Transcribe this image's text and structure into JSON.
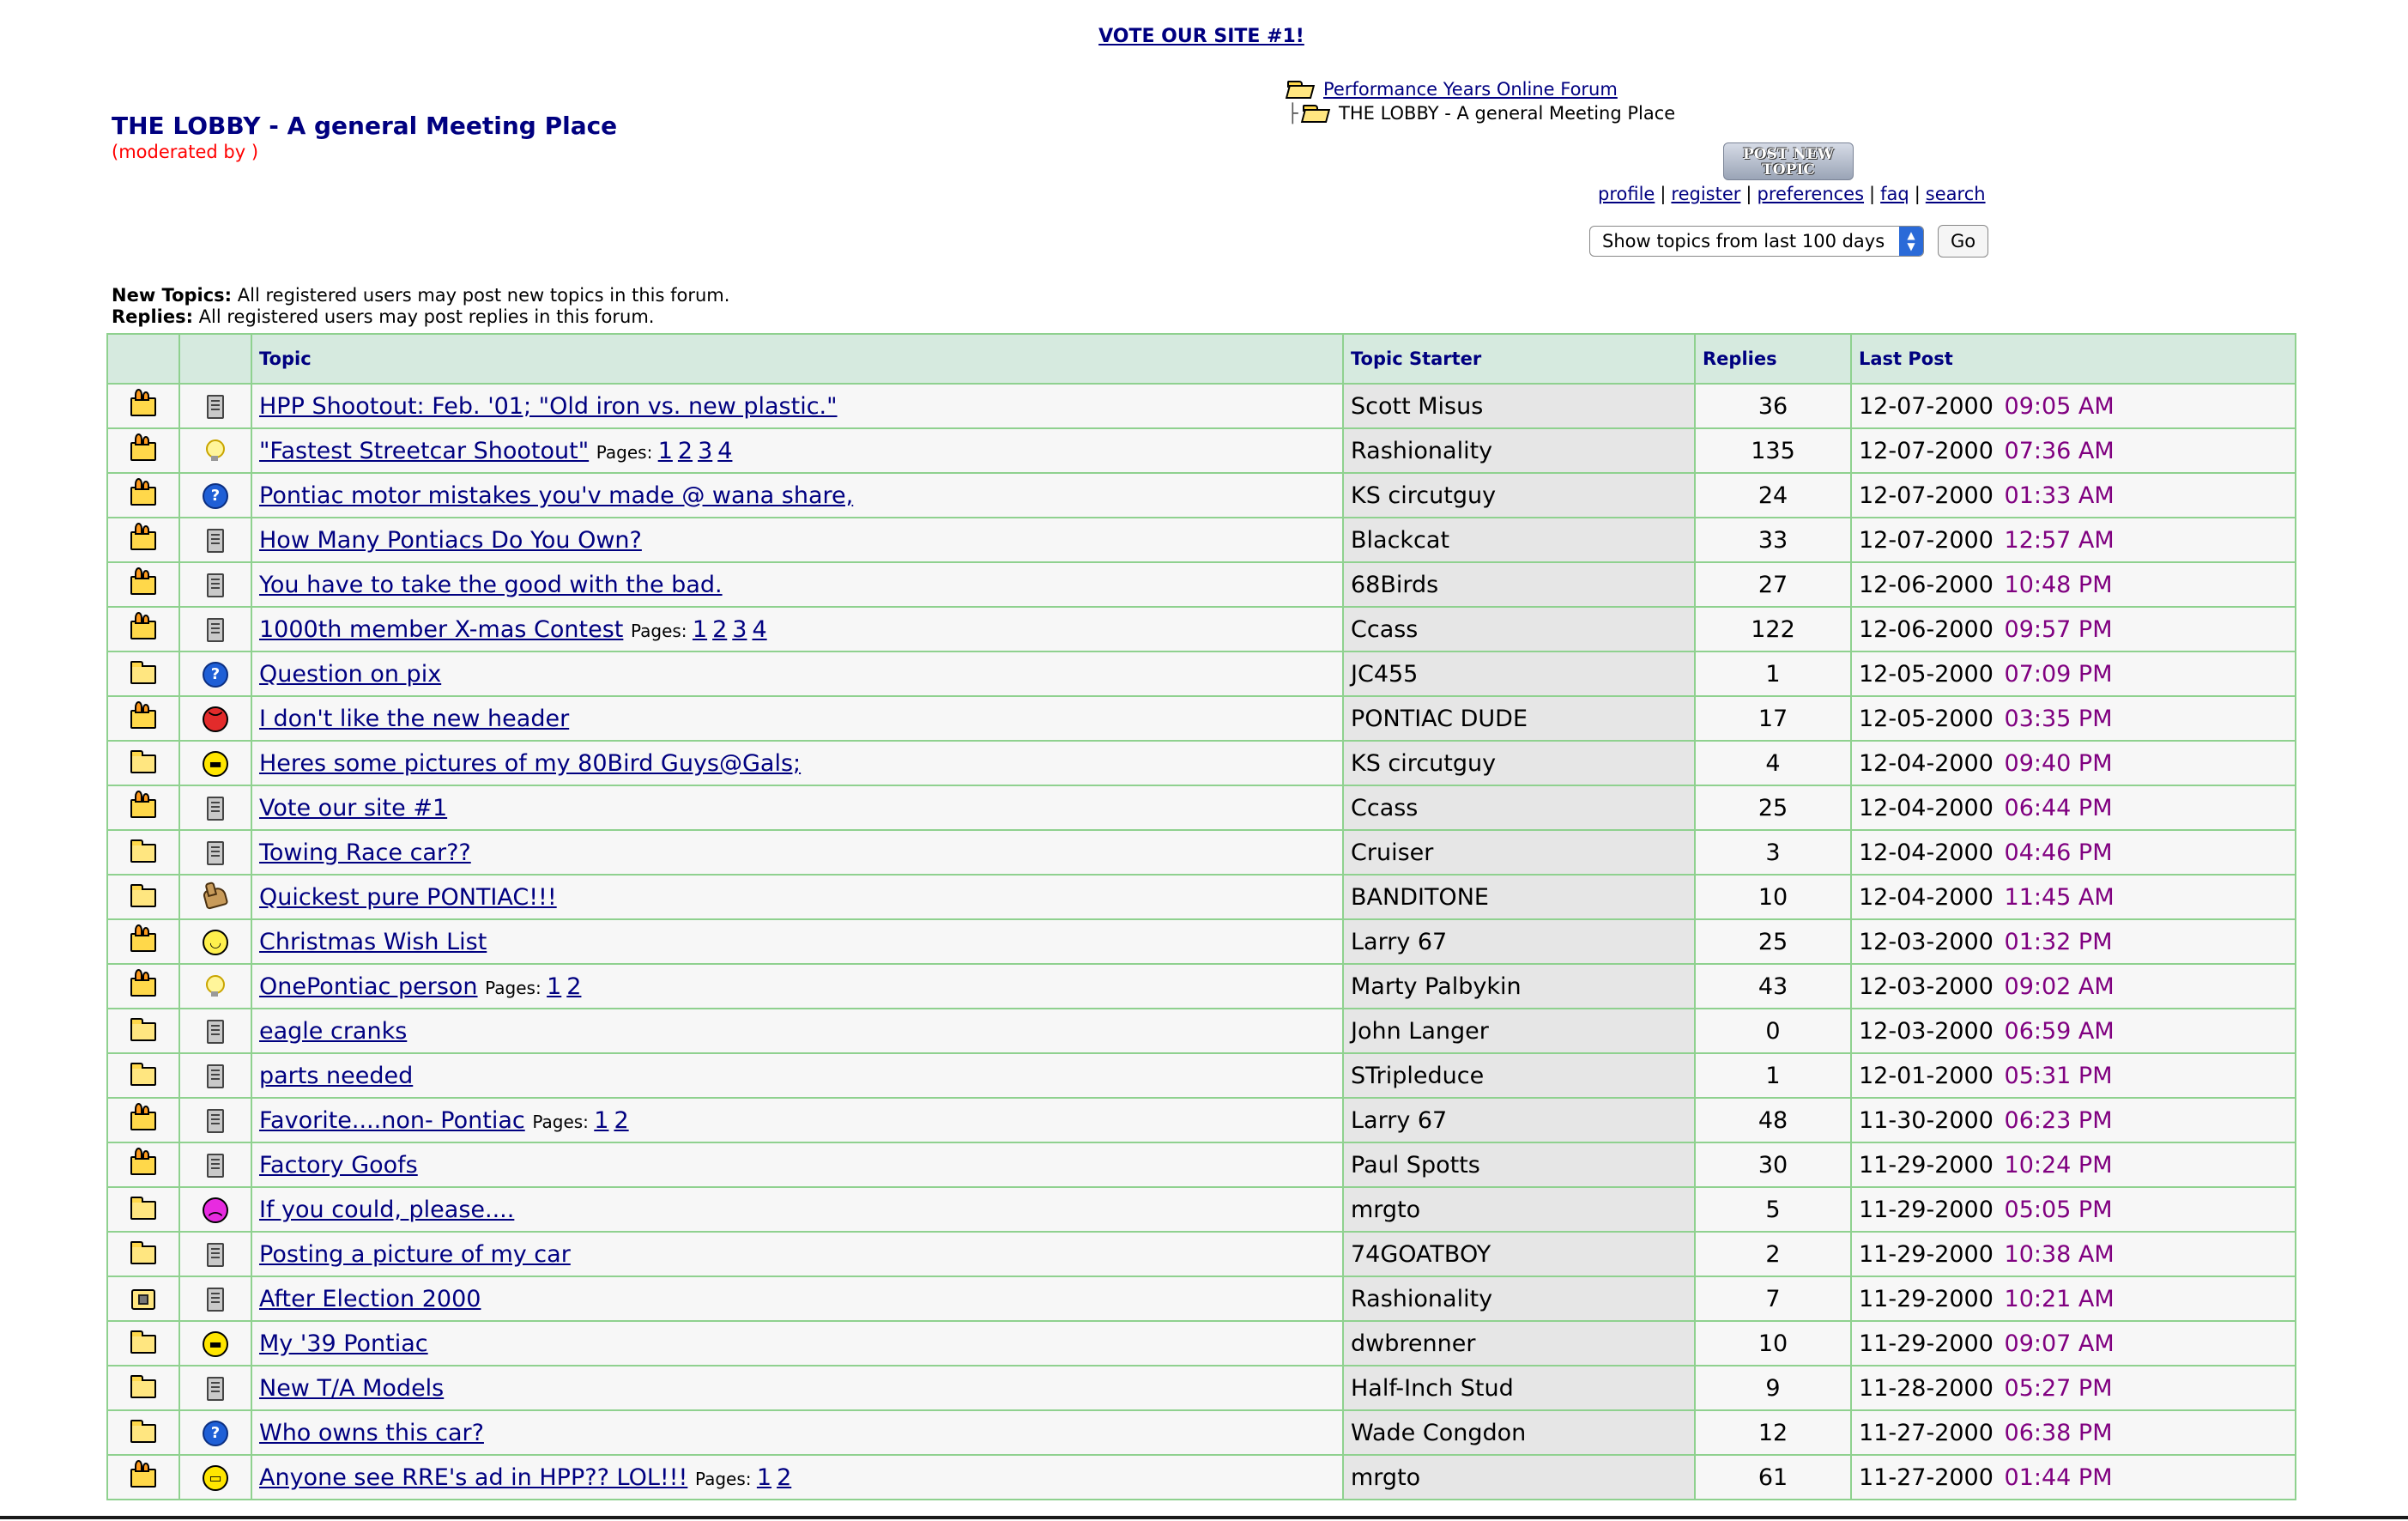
{
  "vote_link": "VOTE OUR SITE #1!",
  "forum": {
    "title": "THE LOBBY - A general Meeting Place",
    "moderated": "(moderated by )"
  },
  "breadcrumb": {
    "root": "Performance Years Online Forum",
    "current": "THE LOBBY - A general Meeting Place"
  },
  "post_new_topic": "POST NEW TOPIC",
  "nav_links": [
    "profile",
    "register",
    "preferences",
    "faq",
    "search"
  ],
  "range_select": {
    "value": "Show topics from last 100 days"
  },
  "go_button": "Go",
  "permissions": {
    "new_topics_label": "New Topics:",
    "new_topics_text": "All registered users may post new topics in this forum.",
    "replies_label": "Replies:",
    "replies_text": "All registered users may post replies in this forum."
  },
  "table": {
    "headers": [
      "",
      "",
      "Topic",
      "Topic Starter",
      "Replies",
      "Last Post"
    ],
    "pages_label": "Pages:",
    "rows": [
      {
        "status": "hot",
        "icon": "doc",
        "topic": "HPP Shootout: Feb. '01; \"Old iron vs. new plastic.\"",
        "pages": [],
        "starter": "Scott Misus",
        "replies": "36",
        "date": "12-07-2000",
        "time": "09:05 AM"
      },
      {
        "status": "hot",
        "icon": "bulb",
        "topic": "\"Fastest Streetcar Shootout\"",
        "pages": [
          "1",
          "2",
          "3",
          "4"
        ],
        "starter": "Rashionality",
        "replies": "135",
        "date": "12-07-2000",
        "time": "07:36 AM"
      },
      {
        "status": "hot",
        "icon": "question",
        "topic": "Pontiac motor mistakes you'v made @ wana share,",
        "pages": [],
        "starter": "KS circutguy",
        "replies": "24",
        "date": "12-07-2000",
        "time": "01:33 AM"
      },
      {
        "status": "hot",
        "icon": "doc",
        "topic": "How Many Pontiacs Do You Own?",
        "pages": [],
        "starter": "Blackcat",
        "replies": "33",
        "date": "12-07-2000",
        "time": "12:57 AM"
      },
      {
        "status": "hot",
        "icon": "doc",
        "topic": "You have to take the good with the bad.",
        "pages": [],
        "starter": "68Birds",
        "replies": "27",
        "date": "12-06-2000",
        "time": "10:48 PM"
      },
      {
        "status": "hot",
        "icon": "doc",
        "topic": "1000th member X-mas Contest",
        "pages": [
          "1",
          "2",
          "3",
          "4"
        ],
        "starter": "Ccass",
        "replies": "122",
        "date": "12-06-2000",
        "time": "09:57 PM"
      },
      {
        "status": "folder",
        "icon": "question",
        "topic": "Question on pix",
        "pages": [],
        "starter": "JC455",
        "replies": "1",
        "date": "12-05-2000",
        "time": "07:09 PM"
      },
      {
        "status": "hot",
        "icon": "angry",
        "topic": "I don't like the new header",
        "pages": [],
        "starter": "PONTIAC DUDE",
        "replies": "17",
        "date": "12-05-2000",
        "time": "03:35 PM"
      },
      {
        "status": "folder",
        "icon": "cool",
        "topic": "Heres some pictures of my 80Bird Guys@Gals;",
        "pages": [],
        "starter": "KS circutguy",
        "replies": "4",
        "date": "12-04-2000",
        "time": "09:40 PM"
      },
      {
        "status": "hot",
        "icon": "doc",
        "topic": "Vote our site #1",
        "pages": [],
        "starter": "Ccass",
        "replies": "25",
        "date": "12-04-2000",
        "time": "06:44 PM"
      },
      {
        "status": "folder",
        "icon": "doc",
        "topic": "Towing Race car??",
        "pages": [],
        "starter": "Cruiser",
        "replies": "3",
        "date": "12-04-2000",
        "time": "04:46 PM"
      },
      {
        "status": "folder",
        "icon": "thumb",
        "topic": "Quickest pure PONTIAC!!!",
        "pages": [],
        "starter": "BANDITONE",
        "replies": "10",
        "date": "12-04-2000",
        "time": "11:45 AM"
      },
      {
        "status": "hot",
        "icon": "smile",
        "topic": "Christmas Wish List",
        "pages": [],
        "starter": "Larry 67",
        "replies": "25",
        "date": "12-03-2000",
        "time": "01:32 PM"
      },
      {
        "status": "hot",
        "icon": "bulb",
        "topic": "OnePontiac person",
        "pages": [
          "1",
          "2"
        ],
        "starter": "Marty Palbykin",
        "replies": "43",
        "date": "12-03-2000",
        "time": "09:02 AM"
      },
      {
        "status": "folder",
        "icon": "doc",
        "topic": "eagle cranks",
        "pages": [],
        "starter": "John Langer",
        "replies": "0",
        "date": "12-03-2000",
        "time": "06:59 AM"
      },
      {
        "status": "folder",
        "icon": "doc",
        "topic": "parts needed",
        "pages": [],
        "starter": "STripleduce",
        "replies": "1",
        "date": "12-01-2000",
        "time": "05:31 PM"
      },
      {
        "status": "hot",
        "icon": "doc",
        "topic": "Favorite....non- Pontiac",
        "pages": [
          "1",
          "2"
        ],
        "starter": "Larry 67",
        "replies": "48",
        "date": "11-30-2000",
        "time": "06:23 PM"
      },
      {
        "status": "hot",
        "icon": "doc",
        "topic": "Factory Goofs",
        "pages": [],
        "starter": "Paul Spotts",
        "replies": "30",
        "date": "11-29-2000",
        "time": "10:24 PM"
      },
      {
        "status": "folder",
        "icon": "sad",
        "topic": "If you could, please....",
        "pages": [],
        "starter": "mrgto",
        "replies": "5",
        "date": "11-29-2000",
        "time": "05:05 PM"
      },
      {
        "status": "folder",
        "icon": "doc",
        "topic": "Posting a picture of my car",
        "pages": [],
        "starter": "74GOATBOY",
        "replies": "2",
        "date": "11-29-2000",
        "time": "10:38 AM"
      },
      {
        "status": "locked",
        "icon": "doc",
        "topic": "After Election 2000",
        "pages": [],
        "starter": "Rashionality",
        "replies": "7",
        "date": "11-29-2000",
        "time": "10:21 AM"
      },
      {
        "status": "folder",
        "icon": "cool",
        "topic": "My '39 Pontiac",
        "pages": [],
        "starter": "dwbrenner",
        "replies": "10",
        "date": "11-29-2000",
        "time": "09:07 AM"
      },
      {
        "status": "folder",
        "icon": "doc",
        "topic": "New T/A Models",
        "pages": [],
        "starter": "Half-Inch Stud",
        "replies": "9",
        "date": "11-28-2000",
        "time": "05:27 PM"
      },
      {
        "status": "folder",
        "icon": "question",
        "topic": "Who owns this car?",
        "pages": [],
        "starter": "Wade Congdon",
        "replies": "12",
        "date": "11-27-2000",
        "time": "06:38 PM"
      },
      {
        "status": "hot",
        "icon": "grin",
        "topic": "Anyone see RRE's ad in HPP?? LOL!!!",
        "pages": [
          "1",
          "2"
        ],
        "starter": "mrgto",
        "replies": "61",
        "date": "11-27-2000",
        "time": "01:44 PM"
      }
    ]
  }
}
